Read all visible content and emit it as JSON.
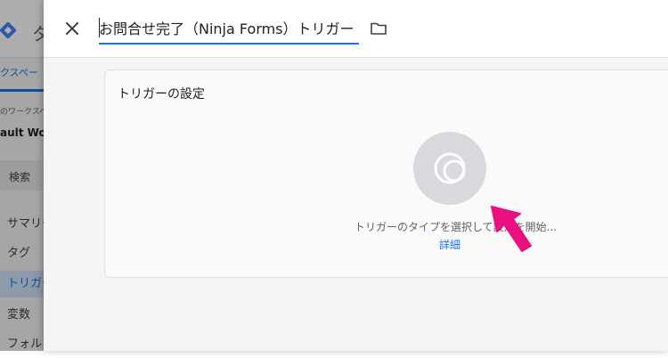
{
  "background": {
    "app_name": "タ",
    "tab_label": "クスペー",
    "workspace_caption": "のワークスペ",
    "workspace_name": "ault Work",
    "search_label": "検索",
    "nav": [
      {
        "label": "サマリー",
        "active": false
      },
      {
        "label": "タグ",
        "active": false
      },
      {
        "label": "トリガー",
        "active": true
      },
      {
        "label": "変数",
        "active": false
      },
      {
        "label": "フォル",
        "active": false
      }
    ]
  },
  "sheet": {
    "title_value": "お問合せ完了（Ninja Forms）トリガー",
    "close_icon": "close-icon",
    "folder_icon": "folder-icon",
    "card": {
      "title": "トリガーの設定",
      "prompt": "トリガーのタイプを選択して設定を開始...",
      "details_link": "詳細",
      "type_icon": "trigger-type-icon"
    }
  },
  "colors": {
    "accent": "#1a73e8",
    "pointer": "#e8117f",
    "placeholder_circle": "#d7d9dd"
  }
}
